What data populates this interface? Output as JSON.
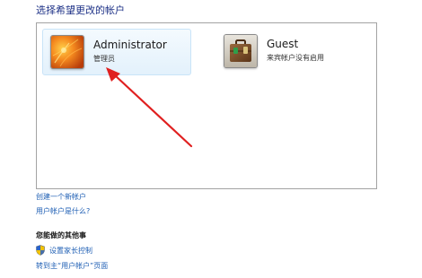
{
  "heading": "选择希望更改的帐户",
  "accounts": [
    {
      "name": "Administrator",
      "type": "管理员",
      "avatar": "orange-flower-picture-icon"
    },
    {
      "name": "Guest",
      "type": "来宾帐户没有启用",
      "avatar": "briefcase-picture-icon"
    }
  ],
  "links": {
    "create_account": "创建一个新帐户",
    "what_is_account": "用户帐户是什么?"
  },
  "other_actions": {
    "title": "您能做的其他事",
    "parental_controls": "设置家长控制",
    "goto_main": "转到主“用户帐户”页面",
    "shield_icon": "uac-shield-icon"
  },
  "colors": {
    "link": "#1f5fb4",
    "heading": "#1e3287",
    "arrow": "#e02020",
    "selection": "#e3f1fc"
  }
}
